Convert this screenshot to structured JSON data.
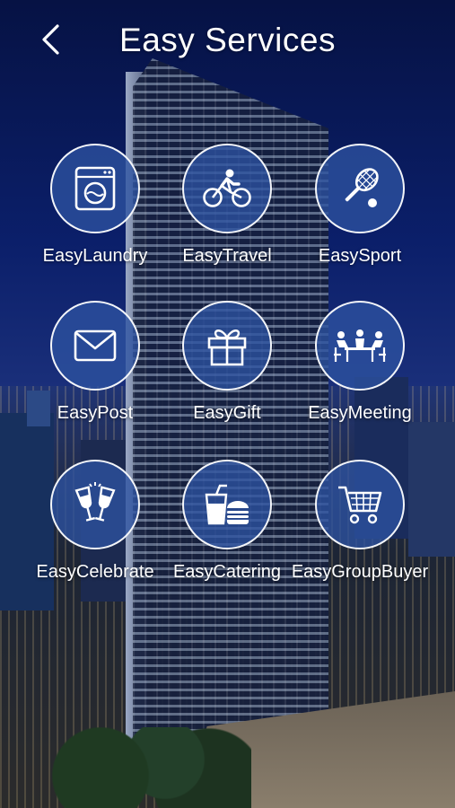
{
  "header": {
    "title": "Easy Services",
    "back_icon": "chevron-left-icon"
  },
  "services": [
    {
      "label": "EasyLaundry",
      "icon": "washing-machine-icon"
    },
    {
      "label": "EasyTravel",
      "icon": "bicycle-icon"
    },
    {
      "label": "EasySport",
      "icon": "tennis-racket-icon"
    },
    {
      "label": "EasyPost",
      "icon": "envelope-icon"
    },
    {
      "label": "EasyGift",
      "icon": "gift-icon"
    },
    {
      "label": "EasyMeeting",
      "icon": "meeting-icon"
    },
    {
      "label": "EasyCelebrate",
      "icon": "champagne-glasses-icon"
    },
    {
      "label": "EasyCatering",
      "icon": "fast-food-icon"
    },
    {
      "label": "EasyGroupBuyer",
      "icon": "shopping-cart-icon"
    }
  ],
  "colors": {
    "circle_fill": "#2d52a0",
    "text": "#ffffff"
  }
}
